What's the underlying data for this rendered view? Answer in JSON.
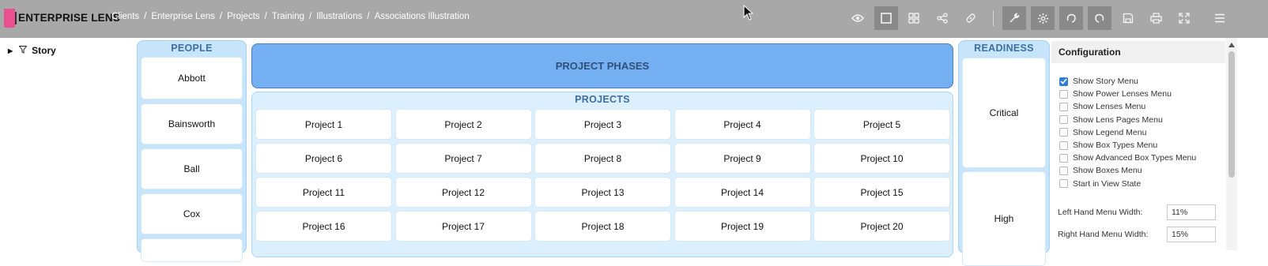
{
  "app": {
    "logo_text": "ENTERPRISE LENS",
    "brand_color": "#e8508f"
  },
  "breadcrumbs": [
    "Clients",
    "Enterprise Lens",
    "Projects",
    "Training",
    "Illustrations",
    "Associations Illustration"
  ],
  "toolbar": {
    "buttons": [
      {
        "icon": "eye-icon"
      },
      {
        "icon": "square-icon",
        "active": true
      },
      {
        "icon": "grid-icon"
      },
      {
        "icon": "share-icon"
      },
      {
        "icon": "link-icon"
      },
      {
        "icon": "wrench-icon"
      },
      {
        "icon": "gear-icon"
      },
      {
        "icon": "undo-icon"
      },
      {
        "icon": "redo-icon"
      },
      {
        "icon": "save-icon"
      },
      {
        "icon": "print-icon"
      },
      {
        "icon": "fullscreen-icon"
      },
      {
        "icon": "menu-icon"
      }
    ]
  },
  "tree": {
    "root_label": "Story"
  },
  "canvas": {
    "people": {
      "title": "PEOPLE",
      "items": [
        "Abbott",
        "Bainsworth",
        "Ball",
        "Cox"
      ]
    },
    "phases": {
      "title": "PROJECT PHASES"
    },
    "projects": {
      "title": "PROJECTS",
      "items": [
        "Project 1",
        "Project 2",
        "Project 3",
        "Project 4",
        "Project 5",
        "Project 6",
        "Project 7",
        "Project 8",
        "Project 9",
        "Project 10",
        "Project 11",
        "Project 12",
        "Project 13",
        "Project 14",
        "Project 15",
        "Project 16",
        "Project 17",
        "Project 18",
        "Project 19",
        "Project 20"
      ]
    },
    "readiness": {
      "title": "READINESS",
      "items": [
        "Critical",
        "High"
      ]
    }
  },
  "config": {
    "title": "Configuration",
    "options": [
      {
        "label": "Show Story Menu",
        "checked": true
      },
      {
        "label": "Show Power Lenses Menu",
        "checked": false
      },
      {
        "label": "Show Lenses Menu",
        "checked": false
      },
      {
        "label": "Show Lens Pages Menu",
        "checked": false
      },
      {
        "label": "Show Legend Menu",
        "checked": false
      },
      {
        "label": "Show Box Types Menu",
        "checked": false
      },
      {
        "label": "Show Advanced Box Types Menu",
        "checked": false
      },
      {
        "label": "Show Boxes Menu",
        "checked": false
      },
      {
        "label": "Start in View State",
        "checked": false
      }
    ],
    "left_menu_width_label": "Left Hand Menu Width:",
    "left_menu_width_value": "11%",
    "right_menu_width_label": "Right Hand Menu Width:",
    "right_menu_width_value": "15%"
  }
}
